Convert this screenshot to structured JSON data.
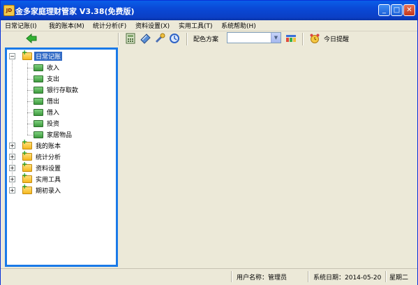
{
  "window": {
    "title": "金多家庭理财管家 V3.38(免费版)",
    "app_icon_text": "JD",
    "minimize_glyph": "_",
    "maximize_glyph": "□",
    "close_glyph": "✕"
  },
  "menubar": {
    "items": [
      {
        "label": "日常记账(I)"
      },
      {
        "label": "我的账本(M)"
      },
      {
        "label": "统计分析(F)"
      },
      {
        "label": "资料设置(X)"
      },
      {
        "label": "实用工具(T)"
      },
      {
        "label": "系统帮助(H)"
      }
    ]
  },
  "toolbar": {
    "back_icon": "back-arrow-icon",
    "icons": [
      "calculator-icon",
      "notebook-icon",
      "tools-icon",
      "refresh-icon"
    ],
    "color_scheme_label": "配色方案",
    "color_scheme_value": "",
    "palette_icon": "palette-icon",
    "alarm_icon": "alarm-clock-icon",
    "reminder_label": "今日提醒"
  },
  "tree": {
    "root": {
      "label": "日常记账",
      "expanded": true,
      "children": [
        "收入",
        "支出",
        "银行存取款",
        "借出",
        "借入",
        "投资",
        "家居物品"
      ]
    },
    "collapsed": [
      "我的账本",
      "统计分析",
      "资料设置",
      "实用工具",
      "期初录入"
    ]
  },
  "status": {
    "user_label": "用户名称：管理员",
    "date_label": "系统日期：2014-05-20",
    "weekday": "星期二"
  },
  "colors": {
    "titlebar": "#0a49d6",
    "tree_border": "#1a7ae8",
    "selection": "#316ac5",
    "background": "#ece9d8"
  }
}
